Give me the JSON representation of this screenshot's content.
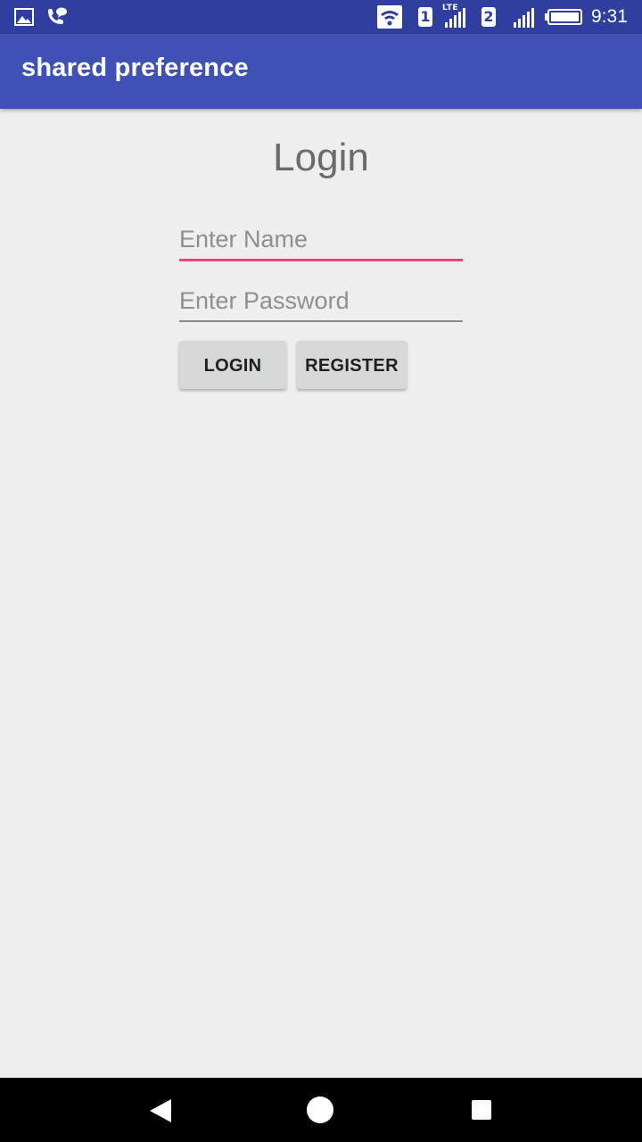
{
  "status_bar": {
    "time": "9:31",
    "sim1": "1",
    "sim2": "2",
    "network_type": "LTE",
    "icons": [
      "image-notification-icon",
      "call-notification-icon",
      "wifi-icon",
      "signal-icon",
      "battery-icon"
    ]
  },
  "app_bar": {
    "title": "shared preference"
  },
  "main": {
    "title": "Login",
    "name_field": {
      "placeholder": "Enter Name",
      "value": ""
    },
    "password_field": {
      "placeholder": "Enter Password",
      "value": ""
    },
    "login_button": "LOGIN",
    "register_button": "REGISTER"
  },
  "nav_bar": {
    "icons": [
      "back-icon",
      "home-icon",
      "recents-icon"
    ]
  },
  "colors": {
    "status_bar": "#303f9f",
    "app_bar": "#3f51b5",
    "accent": "#e2467d",
    "background": "#eeeeee",
    "button": "#d6d7d7"
  }
}
